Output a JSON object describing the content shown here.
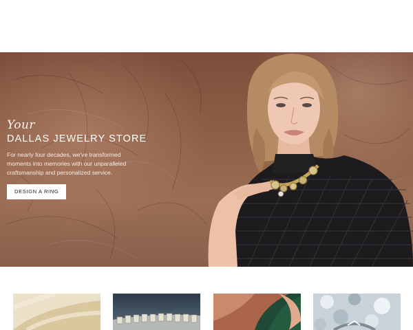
{
  "hero": {
    "script_word": "Your",
    "title": "DALLAS JEWELRY STORE",
    "description_lines": [
      "For nearly four decades, we've transformed",
      "moments into memories with our unparalleled",
      "craftsmanship and personalized service."
    ],
    "cta_label": "DESIGN A RING"
  },
  "thumbnails": [
    {
      "name": "cream-fabric"
    },
    {
      "name": "diamond-bracelet"
    },
    {
      "name": "emerald-hand"
    },
    {
      "name": "sparkle-ring"
    }
  ]
}
